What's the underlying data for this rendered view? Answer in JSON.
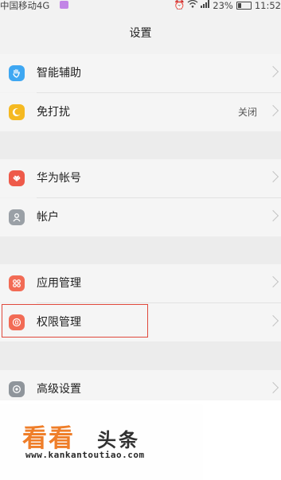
{
  "status_bar": {
    "carrier": "中国移动4G",
    "battery": "23%",
    "time": "11:52",
    "icons": [
      "message-icon",
      "alarm-icon",
      "wifi-icon",
      "signal-icon",
      "battery-icon"
    ]
  },
  "title": "设置",
  "groups": [
    {
      "items": [
        {
          "label": "智能辅助",
          "icon": "hand-icon",
          "color": "#3ea7f2",
          "value": ""
        },
        {
          "label": "免打扰",
          "icon": "moon-icon",
          "color": "#f5b921",
          "value": "关闭"
        }
      ]
    },
    {
      "items": [
        {
          "label": "华为帐号",
          "icon": "huawei-icon",
          "color": "#ee5a4a",
          "value": ""
        },
        {
          "label": "帐户",
          "icon": "account-icon",
          "color": "#9aa0a6",
          "value": ""
        }
      ]
    },
    {
      "items": [
        {
          "label": "应用管理",
          "icon": "apps-icon",
          "color": "#f26b55",
          "value": ""
        },
        {
          "label": "权限管理",
          "icon": "permission-icon",
          "color": "#f26b55",
          "value": ""
        }
      ]
    },
    {
      "items": [
        {
          "label": "高级设置",
          "icon": "gear-icon",
          "color": "#8f959b",
          "value": ""
        }
      ]
    }
  ],
  "watermark": {
    "brand": "看看",
    "brand_suffix": "头条",
    "url": "www.kankantoutiao.com",
    "colors": {
      "brand": "#ef7b23"
    }
  }
}
